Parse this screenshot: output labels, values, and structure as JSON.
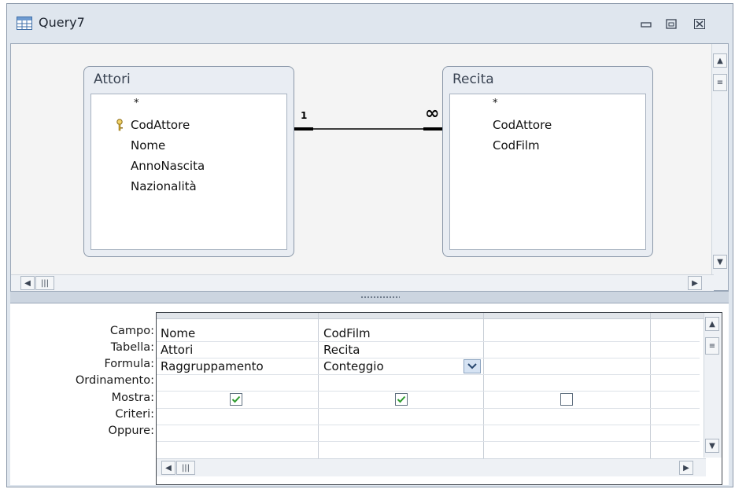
{
  "window": {
    "title": "Query7",
    "icon": "query-icon",
    "controls": [
      "minimize-icon",
      "restore-icon",
      "close-icon"
    ]
  },
  "tables": [
    {
      "name": "Attori",
      "fields": [
        "*",
        "CodAttore",
        "Nome",
        "AnnoNascita",
        "Nazionalità"
      ],
      "key_field": "CodAttore"
    },
    {
      "name": "Recita",
      "fields": [
        "*",
        "CodAttore",
        "CodFilm"
      ]
    }
  ],
  "relationship": {
    "from_label": "1",
    "to_label": "∞"
  },
  "grid": {
    "row_labels": [
      "Campo:",
      "Tabella:",
      "Formula:",
      "Ordinamento:",
      "Mostra:",
      "Criteri:",
      "Oppure:"
    ],
    "columns": [
      {
        "field": "Nome",
        "table": "Attori",
        "total": "Raggruppamento",
        "show": true
      },
      {
        "field": "CodFilm",
        "table": "Recita",
        "total": "Conteggio",
        "show": true,
        "total_dropdown_open": true
      },
      {
        "field": "",
        "table": "",
        "total": "",
        "show": false
      }
    ]
  },
  "colors": {
    "window_frame": "#dfe6ee",
    "accent_check": "#2e9b2e"
  }
}
